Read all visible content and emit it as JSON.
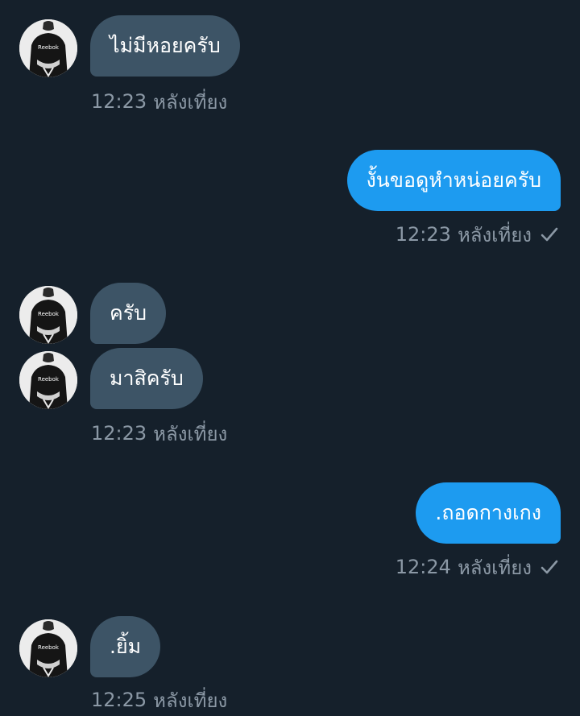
{
  "messages": [
    {
      "direction": "in",
      "text": "ไม่มีหอยครับ"
    },
    {
      "direction": "out",
      "text": "งั้นขอดูหำหน่อยครับ"
    },
    {
      "direction": "in",
      "text": "ครับ"
    },
    {
      "direction": "in",
      "text": "มาสิครับ"
    },
    {
      "direction": "out",
      "text": ".ถอดกางเกง"
    },
    {
      "direction": "in",
      "text": ".ยิ้ม"
    }
  ],
  "timestamps": [
    {
      "time": "12:23",
      "label": "หลังเที่ยง"
    },
    {
      "time": "12:23",
      "label": "หลังเที่ยง"
    },
    {
      "time": "12:23",
      "label": "หลังเที่ยง"
    },
    {
      "time": "12:24",
      "label": "หลังเที่ยง"
    },
    {
      "time": "12:25",
      "label": "หลังเที่ยง"
    }
  ],
  "avatar_logo": "Reebok",
  "icons": {
    "read_receipt": "check-icon",
    "avatar": "avatar-icon"
  },
  "colors": {
    "background": "#15202b",
    "incoming_bubble": "#3d5466",
    "outgoing_bubble": "#1d9bf0",
    "meta_text": "#8b98a5"
  }
}
